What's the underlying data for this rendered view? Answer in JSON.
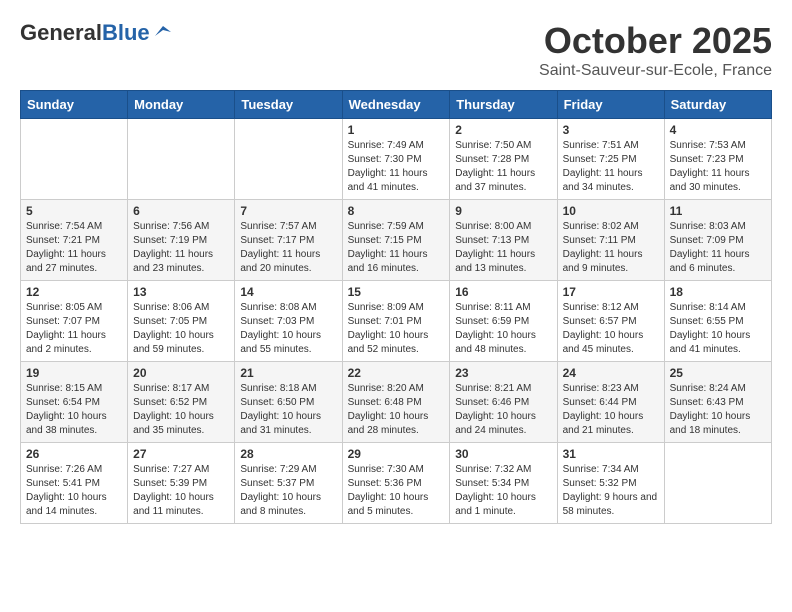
{
  "header": {
    "logo_general": "General",
    "logo_blue": "Blue",
    "month_title": "October 2025",
    "location": "Saint-Sauveur-sur-Ecole, France"
  },
  "days_of_week": [
    "Sunday",
    "Monday",
    "Tuesday",
    "Wednesday",
    "Thursday",
    "Friday",
    "Saturday"
  ],
  "weeks": [
    [
      {
        "day": "",
        "info": ""
      },
      {
        "day": "",
        "info": ""
      },
      {
        "day": "",
        "info": ""
      },
      {
        "day": "1",
        "info": "Sunrise: 7:49 AM\nSunset: 7:30 PM\nDaylight: 11 hours and 41 minutes."
      },
      {
        "day": "2",
        "info": "Sunrise: 7:50 AM\nSunset: 7:28 PM\nDaylight: 11 hours and 37 minutes."
      },
      {
        "day": "3",
        "info": "Sunrise: 7:51 AM\nSunset: 7:25 PM\nDaylight: 11 hours and 34 minutes."
      },
      {
        "day": "4",
        "info": "Sunrise: 7:53 AM\nSunset: 7:23 PM\nDaylight: 11 hours and 30 minutes."
      }
    ],
    [
      {
        "day": "5",
        "info": "Sunrise: 7:54 AM\nSunset: 7:21 PM\nDaylight: 11 hours and 27 minutes."
      },
      {
        "day": "6",
        "info": "Sunrise: 7:56 AM\nSunset: 7:19 PM\nDaylight: 11 hours and 23 minutes."
      },
      {
        "day": "7",
        "info": "Sunrise: 7:57 AM\nSunset: 7:17 PM\nDaylight: 11 hours and 20 minutes."
      },
      {
        "day": "8",
        "info": "Sunrise: 7:59 AM\nSunset: 7:15 PM\nDaylight: 11 hours and 16 minutes."
      },
      {
        "day": "9",
        "info": "Sunrise: 8:00 AM\nSunset: 7:13 PM\nDaylight: 11 hours and 13 minutes."
      },
      {
        "day": "10",
        "info": "Sunrise: 8:02 AM\nSunset: 7:11 PM\nDaylight: 11 hours and 9 minutes."
      },
      {
        "day": "11",
        "info": "Sunrise: 8:03 AM\nSunset: 7:09 PM\nDaylight: 11 hours and 6 minutes."
      }
    ],
    [
      {
        "day": "12",
        "info": "Sunrise: 8:05 AM\nSunset: 7:07 PM\nDaylight: 11 hours and 2 minutes."
      },
      {
        "day": "13",
        "info": "Sunrise: 8:06 AM\nSunset: 7:05 PM\nDaylight: 10 hours and 59 minutes."
      },
      {
        "day": "14",
        "info": "Sunrise: 8:08 AM\nSunset: 7:03 PM\nDaylight: 10 hours and 55 minutes."
      },
      {
        "day": "15",
        "info": "Sunrise: 8:09 AM\nSunset: 7:01 PM\nDaylight: 10 hours and 52 minutes."
      },
      {
        "day": "16",
        "info": "Sunrise: 8:11 AM\nSunset: 6:59 PM\nDaylight: 10 hours and 48 minutes."
      },
      {
        "day": "17",
        "info": "Sunrise: 8:12 AM\nSunset: 6:57 PM\nDaylight: 10 hours and 45 minutes."
      },
      {
        "day": "18",
        "info": "Sunrise: 8:14 AM\nSunset: 6:55 PM\nDaylight: 10 hours and 41 minutes."
      }
    ],
    [
      {
        "day": "19",
        "info": "Sunrise: 8:15 AM\nSunset: 6:54 PM\nDaylight: 10 hours and 38 minutes."
      },
      {
        "day": "20",
        "info": "Sunrise: 8:17 AM\nSunset: 6:52 PM\nDaylight: 10 hours and 35 minutes."
      },
      {
        "day": "21",
        "info": "Sunrise: 8:18 AM\nSunset: 6:50 PM\nDaylight: 10 hours and 31 minutes."
      },
      {
        "day": "22",
        "info": "Sunrise: 8:20 AM\nSunset: 6:48 PM\nDaylight: 10 hours and 28 minutes."
      },
      {
        "day": "23",
        "info": "Sunrise: 8:21 AM\nSunset: 6:46 PM\nDaylight: 10 hours and 24 minutes."
      },
      {
        "day": "24",
        "info": "Sunrise: 8:23 AM\nSunset: 6:44 PM\nDaylight: 10 hours and 21 minutes."
      },
      {
        "day": "25",
        "info": "Sunrise: 8:24 AM\nSunset: 6:43 PM\nDaylight: 10 hours and 18 minutes."
      }
    ],
    [
      {
        "day": "26",
        "info": "Sunrise: 7:26 AM\nSunset: 5:41 PM\nDaylight: 10 hours and 14 minutes."
      },
      {
        "day": "27",
        "info": "Sunrise: 7:27 AM\nSunset: 5:39 PM\nDaylight: 10 hours and 11 minutes."
      },
      {
        "day": "28",
        "info": "Sunrise: 7:29 AM\nSunset: 5:37 PM\nDaylight: 10 hours and 8 minutes."
      },
      {
        "day": "29",
        "info": "Sunrise: 7:30 AM\nSunset: 5:36 PM\nDaylight: 10 hours and 5 minutes."
      },
      {
        "day": "30",
        "info": "Sunrise: 7:32 AM\nSunset: 5:34 PM\nDaylight: 10 hours and 1 minute."
      },
      {
        "day": "31",
        "info": "Sunrise: 7:34 AM\nSunset: 5:32 PM\nDaylight: 9 hours and 58 minutes."
      },
      {
        "day": "",
        "info": ""
      }
    ]
  ]
}
